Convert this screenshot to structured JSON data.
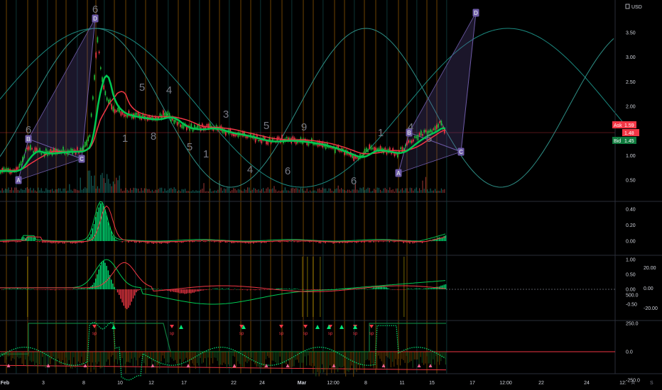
{
  "currency": "USD",
  "price_axis": {
    "ticks": [
      "3.50",
      "3.00",
      "2.50",
      "2.00",
      "1.50",
      "1.00",
      "0.50"
    ],
    "ask_label": "Ask",
    "ask_value": "1.59",
    "last_value": "1.48",
    "bid_label": "Bid",
    "bid_value": "1.45"
  },
  "osc1_axis": {
    "ticks": [
      "0.40",
      "0.20",
      "0.00"
    ]
  },
  "osc2_axis": {
    "left_ticks": [
      "1.00",
      "0.50",
      "0.00",
      "-0.50"
    ],
    "right_ticks": [
      "20.00",
      "0.00",
      "-20.00"
    ]
  },
  "osc3_axis": {
    "ticks": [
      "500.0",
      "250.0",
      "0.0",
      "-250.0"
    ]
  },
  "date_axis": [
    {
      "label": "Feb",
      "bold": true
    },
    {
      "label": "3",
      "bold": false
    },
    {
      "label": "8",
      "bold": false
    },
    {
      "label": "10",
      "bold": false
    },
    {
      "label": "12",
      "bold": false
    },
    {
      "label": "17",
      "bold": false
    },
    {
      "label": "22",
      "bold": false
    },
    {
      "label": "24",
      "bold": false
    },
    {
      "label": "Mar",
      "bold": true
    },
    {
      "label": "12:00",
      "bold": false
    },
    {
      "label": "8",
      "bold": false
    },
    {
      "label": "11",
      "bold": false
    },
    {
      "label": "15",
      "bold": false
    },
    {
      "label": "17",
      "bold": false
    },
    {
      "label": "12:00",
      "bold": false
    },
    {
      "label": "22",
      "bold": false
    },
    {
      "label": "24",
      "bold": false
    },
    {
      "label": "12:",
      "bold": false
    }
  ],
  "axis_buttons": [
    "A",
    "S"
  ],
  "pattern_points": [
    "A",
    "B",
    "C",
    "D",
    "A",
    "B",
    "C",
    "D"
  ],
  "wave_labels": [
    "6",
    "1",
    "5",
    "8",
    "4",
    "5",
    "1",
    "3",
    "4",
    "5",
    "6",
    "9",
    "6",
    "1",
    "4",
    "5",
    "6"
  ],
  "signals": [
    "sp",
    "sp",
    "sp",
    "sp",
    "sp",
    "sp",
    "sp",
    "sp"
  ],
  "colors": {
    "background": "#000000",
    "bull": "#26a69a",
    "bull_bright": "#00e676",
    "bear": "#f23645",
    "cycle": "#1b8a80",
    "pattern": "#5b4a8a",
    "vline_orange": "#7a4a00",
    "vline_teal": "#0e3b3a",
    "ask": "#f23645",
    "bid": "#0f7a3d"
  },
  "chart_data": {
    "type": "candlestick",
    "symbol_currency": "USD",
    "ylim": [
      0.35,
      3.75
    ],
    "price_path": [
      {
        "x": "Feb 1",
        "y": 0.7
      },
      {
        "x": "Feb 3",
        "y": 0.78
      },
      {
        "x": "Feb 6",
        "y": 1.2
      },
      {
        "x": "Feb 8",
        "y": 3.45
      },
      {
        "x": "Feb 9",
        "y": 2.3
      },
      {
        "x": "Feb 10",
        "y": 1.95
      },
      {
        "x": "Feb 12",
        "y": 1.85
      },
      {
        "x": "Feb 17",
        "y": 1.7
      },
      {
        "x": "Feb 22",
        "y": 1.45
      },
      {
        "x": "Feb 24",
        "y": 1.3
      },
      {
        "x": "Mar 1",
        "y": 1.25
      },
      {
        "x": "Mar 8",
        "y": 0.95
      },
      {
        "x": "Mar 11",
        "y": 1.05
      },
      {
        "x": "Mar 15",
        "y": 1.5
      }
    ],
    "abcd_pattern_1": {
      "A": 0.62,
      "B": 1.3,
      "C": 1.05,
      "D": 3.6
    },
    "abcd_pattern_2": {
      "A": 0.75,
      "B": 1.48,
      "C": 1.15,
      "D": 3.75
    },
    "last_price": 1.48,
    "ask": 1.59,
    "bid": 1.45,
    "osc1_ylim": [
      -0.05,
      0.45
    ],
    "osc2_ylim": [
      -0.75,
      1.1
    ],
    "osc3_ylim": [
      -300,
      560
    ]
  }
}
